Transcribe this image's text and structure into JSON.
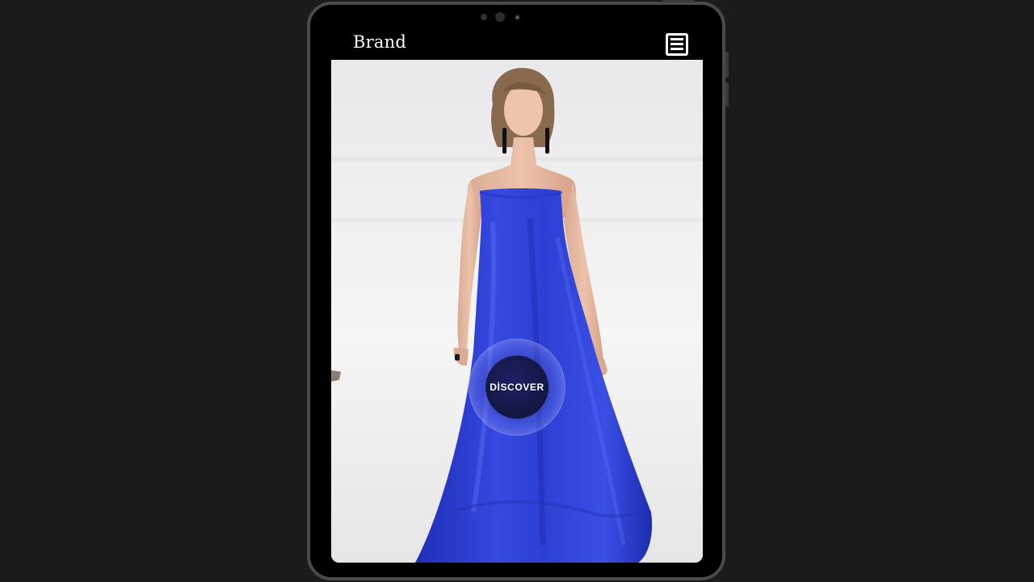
{
  "header": {
    "brand": "Brand",
    "menu_icon": "hamburger-menu-icon"
  },
  "hero": {
    "cta_label": "DİSCOVER",
    "dress_color": "#2f44d6"
  },
  "colors": {
    "page_background": "#1b1b1b",
    "device_frame": "#4a4a4a",
    "navbar": "#000000",
    "cta_background": "#141846",
    "cta_text": "#ffffff"
  }
}
